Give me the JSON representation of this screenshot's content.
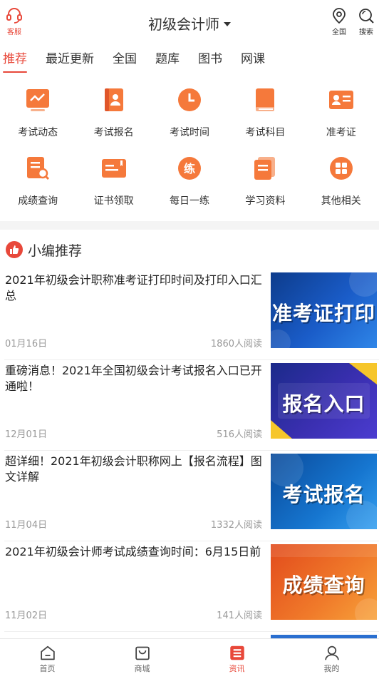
{
  "header": {
    "service_label": "客服",
    "title": "初级会计师",
    "region_label": "全国",
    "search_label": "搜索"
  },
  "tabs": [
    "推荐",
    "最近更新",
    "全国",
    "题库",
    "图书",
    "网课"
  ],
  "grid": [
    {
      "label": "考试动态",
      "icon": "trend-chart-icon"
    },
    {
      "label": "考试报名",
      "icon": "contact-book-icon"
    },
    {
      "label": "考试时间",
      "icon": "clock-icon"
    },
    {
      "label": "考试科目",
      "icon": "book-icon"
    },
    {
      "label": "准考证",
      "icon": "id-card-icon"
    },
    {
      "label": "成绩查询",
      "icon": "document-search-icon"
    },
    {
      "label": "证书领取",
      "icon": "certificate-icon"
    },
    {
      "label": "每日一练",
      "icon": "practice-icon",
      "glyph": "练"
    },
    {
      "label": "学习资料",
      "icon": "documents-icon"
    },
    {
      "label": "其他相关",
      "icon": "grid-apps-icon"
    }
  ],
  "section": {
    "title": "小编推荐"
  },
  "articles": [
    {
      "title": "2021年初级会计职称准考证打印时间及打印入口汇总",
      "date": "01月16日",
      "reads": "1860人阅读",
      "thumb_text": "准考证打印"
    },
    {
      "title": "重磅消息！2021年全国初级会计考试报名入口已开通啦！",
      "date": "12月01日",
      "reads": "516人阅读",
      "thumb_text": "报名入口"
    },
    {
      "title": "超详细！2021年初级会计职称网上【报名流程】图文详解",
      "date": "11月04日",
      "reads": "1332人阅读",
      "thumb_text": "考试报名"
    },
    {
      "title": "2021年初级会计师考试成绩查询时间：6月15日前",
      "date": "11月02日",
      "reads": "141人阅读",
      "thumb_text": "成绩查询"
    }
  ],
  "bottom_nav": [
    {
      "label": "首页",
      "icon": "home-icon"
    },
    {
      "label": "商城",
      "icon": "shopping-bag-icon"
    },
    {
      "label": "资讯",
      "icon": "news-icon"
    },
    {
      "label": "我的",
      "icon": "user-icon"
    }
  ],
  "colors": {
    "accent": "#e8483a",
    "icon_orange": "#f5793b"
  }
}
